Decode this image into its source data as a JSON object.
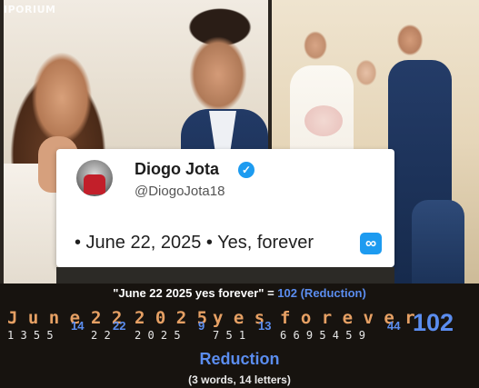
{
  "image": {
    "watermark": "IPORIUM"
  },
  "tweet": {
    "name": "Diogo Jota",
    "handle": "@DiogoJota18",
    "text": "• June 22, 2025 • Yes, forever",
    "verified_icon": "verified-check-icon",
    "badge_icon": "infinity-icon",
    "accent_color": "#1d9bf0"
  },
  "calculation": {
    "phrase": "\"June 22 2025 yes forever\"",
    "equals": "=",
    "result": "102 (Reduction)",
    "words": [
      {
        "letters": "June",
        "digits": "1355",
        "sum": "14"
      },
      {
        "letters": "22",
        "digits": "22",
        "sum": "22"
      },
      {
        "letters": "2025",
        "digits": "2025",
        "sum": "9"
      },
      {
        "letters": "yes",
        "digits": "751",
        "sum": "13"
      },
      {
        "letters": "forever",
        "digits": "6695459",
        "sum": "44"
      }
    ],
    "total": "102",
    "method": "Reduction",
    "stats": "(3 words, 14 letters)",
    "colors": {
      "letters": "#e6a064",
      "value": "#5b8def",
      "digits": "#e8e8e8"
    }
  }
}
